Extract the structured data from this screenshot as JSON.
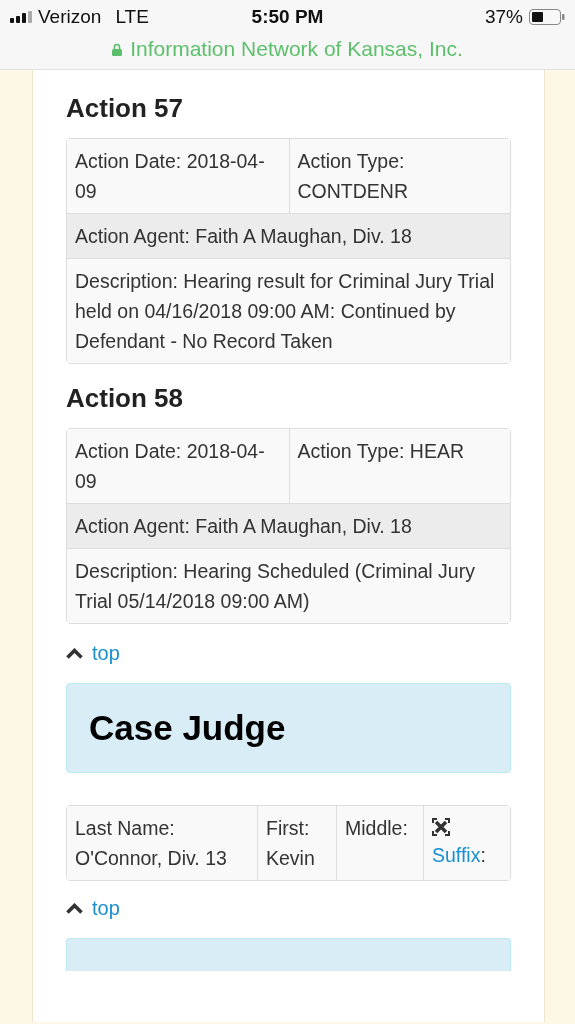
{
  "status_bar": {
    "carrier": "Verizon",
    "network": "LTE",
    "time": "5:50 PM",
    "battery": "37%"
  },
  "address_bar": {
    "title": "Information Network of Kansas, Inc."
  },
  "content": [
    {
      "kind": "action",
      "heading": "Action 57",
      "date": "Action Date: 2018-04-09",
      "type": "Action Type: CONTDENR",
      "agent": "Action Agent: Faith A Maughan, Div. 18",
      "description": "Description: Hearing result for Criminal Jury Trial held on 04/16/2018 09:00 AM: Continued by Defendant - No Record Taken"
    },
    {
      "kind": "action",
      "heading": "Action 58",
      "date": "Action Date: 2018-04-09",
      "type": "Action Type: HEAR",
      "agent": "Action Agent: Faith A Maughan, Div. 18",
      "description": "Description: Hearing Scheduled (Criminal Jury Trial 05/14/2018 09:00 AM)"
    },
    {
      "kind": "top_link",
      "label": "top"
    },
    {
      "kind": "panel",
      "title": "Case Judge"
    },
    {
      "kind": "judge",
      "last_name": "Last Name: O'Connor, Div. 13",
      "first": "First: Kevin",
      "middle": "Middle:",
      "suffix_link": "Suffix",
      "suffix_after": ":"
    },
    {
      "kind": "top_link",
      "label": "top"
    },
    {
      "kind": "panel"
    }
  ]
}
